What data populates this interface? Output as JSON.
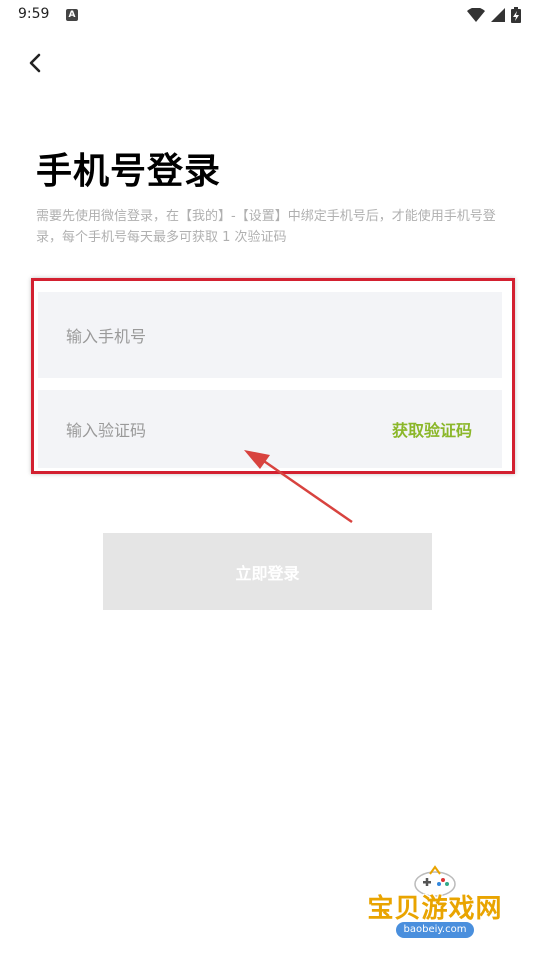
{
  "status_bar": {
    "time": "9:59",
    "notification_icon": "a-box-icon",
    "right_icons": [
      "wifi-icon",
      "signal-icon",
      "battery-charging-icon"
    ]
  },
  "header": {
    "back_icon": "chevron-left-icon"
  },
  "login": {
    "title": "手机号登录",
    "description": "需要先使用微信登录，在【我的】-【设置】中绑定手机号后，才能使用手机号登录，每个手机号每天最多可获取 1 次验证码",
    "phone_placeholder": "输入手机号",
    "code_placeholder": "输入验证码",
    "get_code_label": "获取验证码",
    "submit_label": "立即登录"
  },
  "colors": {
    "accent_green": "#8bb72a",
    "highlight_red": "#d32030",
    "field_bg": "#f3f4f7",
    "button_disabled_bg": "#e5e5e5"
  },
  "watermark": {
    "brand": "宝贝游戏网",
    "domain": "baobeiy.com"
  }
}
